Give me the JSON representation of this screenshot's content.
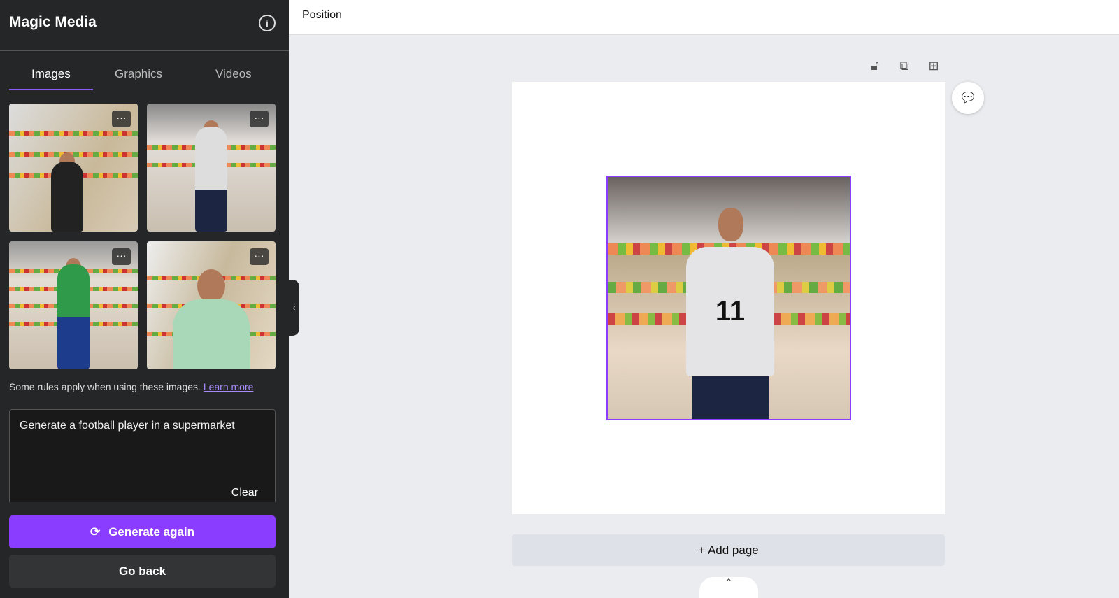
{
  "sidebar": {
    "title": "Magic Media",
    "info_icon": "info-icon",
    "tabs": [
      {
        "label": "Images",
        "active": true
      },
      {
        "label": "Graphics"
      },
      {
        "label": "Videos"
      }
    ],
    "more_label": "···",
    "rules_text": "Some rules apply when using these images.",
    "learn_more": "Learn more",
    "prompt": "Generate a football player in a supermarket",
    "clear_label": "Clear",
    "generate_label": "Generate again",
    "go_back_label": "Go back",
    "accent": "#8b3dff"
  },
  "topbar": {
    "title": "Position"
  },
  "canvas": {
    "add_page": "+ Add page",
    "jersey_number": "11"
  }
}
